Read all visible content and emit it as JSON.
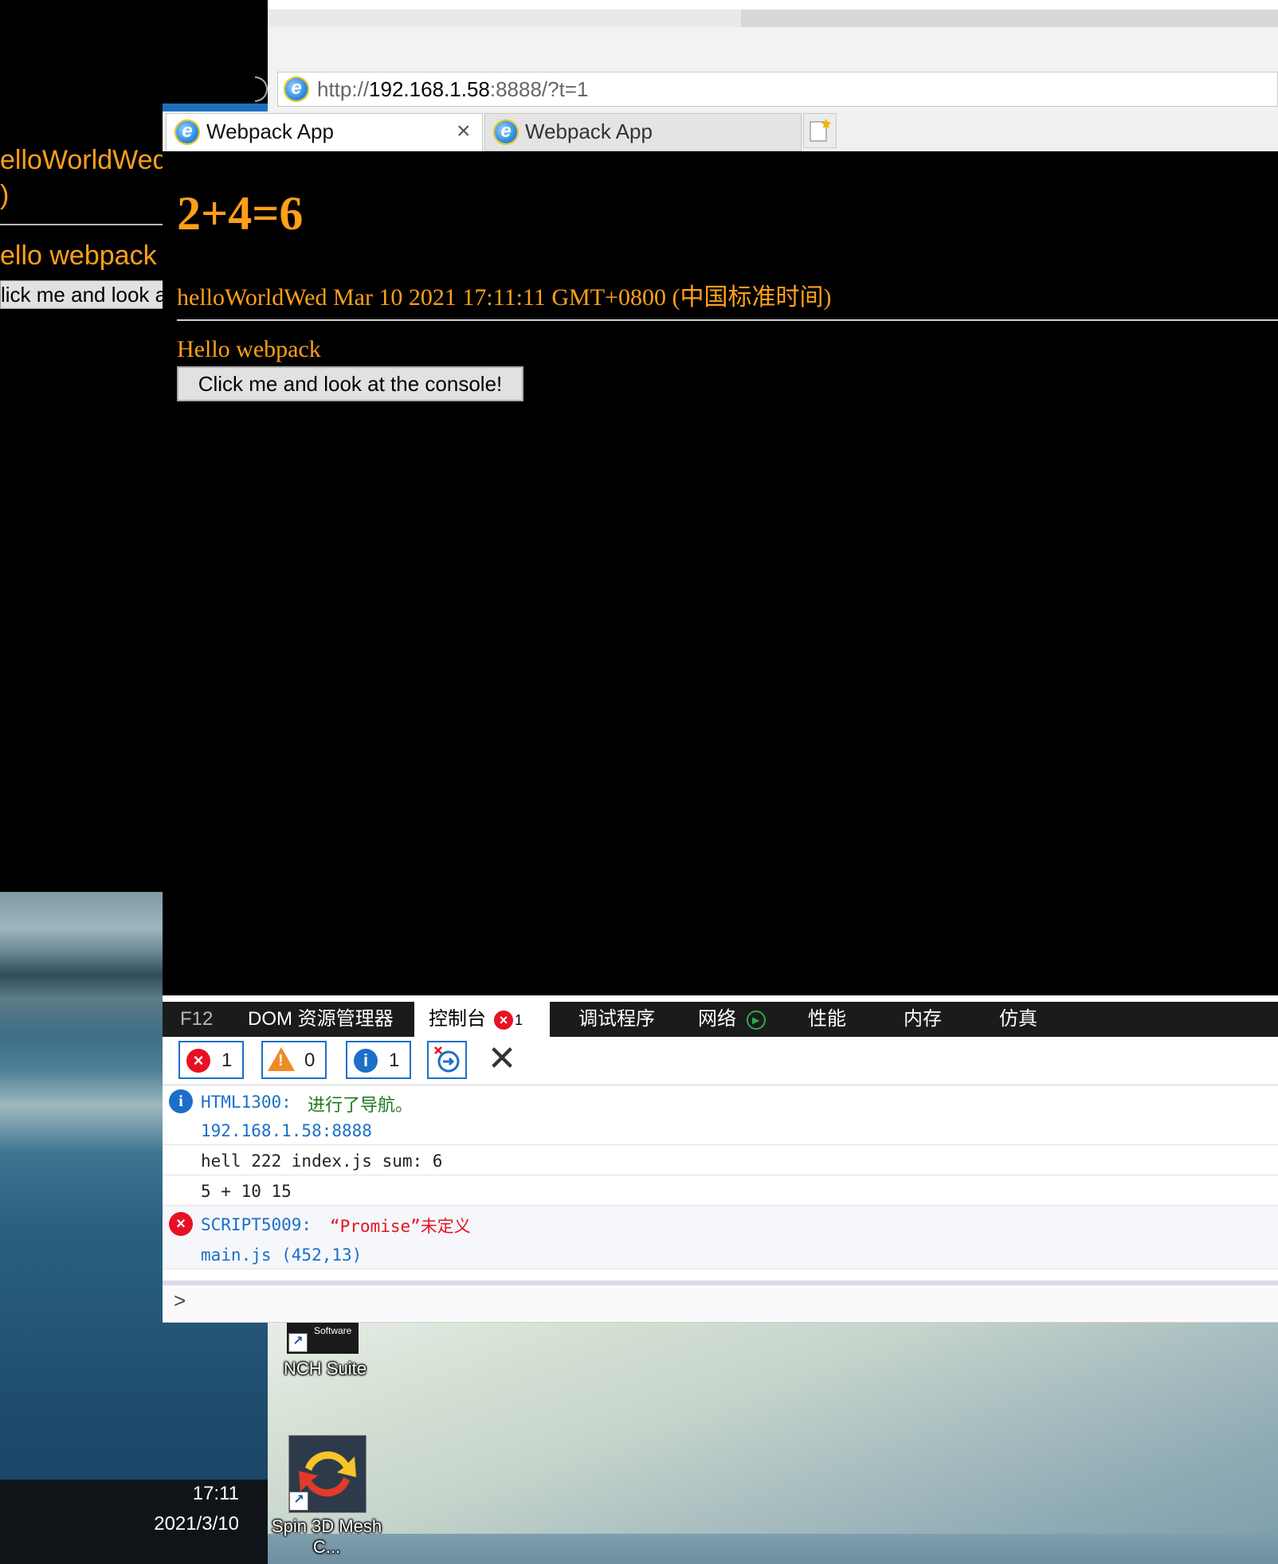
{
  "background_window": {
    "heading_partial": "elloWorldWed",
    "heading_partial_2": ")",
    "hello_partial": "ello webpack",
    "button_partial": "lick me and look a"
  },
  "browser": {
    "address": {
      "prefix": "http://",
      "host": "192.168.1.58",
      "suffix": ":8888/?t=1"
    },
    "tabs": [
      {
        "label": "Webpack App",
        "active": true
      },
      {
        "label": "Webpack App",
        "active": false
      }
    ],
    "close_glyph": "×"
  },
  "page": {
    "heading": "2+4=6",
    "date_line": "helloWorldWed Mar 10 2021 17:11:11 GMT+0800 (中国标准时间)",
    "hello_text": "Hello webpack",
    "button_label": "Click me and look at the console!"
  },
  "devtools": {
    "tabs": [
      {
        "label": "F12"
      },
      {
        "label": "DOM 资源管理器"
      },
      {
        "label": "控制台",
        "badge": "1"
      },
      {
        "label": "调试程序"
      },
      {
        "label": "网络"
      },
      {
        "label": "性能"
      },
      {
        "label": "内存"
      },
      {
        "label": "仿真"
      }
    ],
    "filters": {
      "errors": "1",
      "warnings": "0",
      "info": "1"
    },
    "messages": [
      {
        "type": "info",
        "code": "HTML1300:",
        "text": "进行了导航。",
        "source": "192.168.1.58:8888"
      },
      {
        "type": "log",
        "text": "hell 222 index.js sum: 6"
      },
      {
        "type": "log",
        "text": "5 + 10 15"
      },
      {
        "type": "error",
        "code": "SCRIPT5009:",
        "text": "“Promise”未定义",
        "source": "main.js (452,13)"
      }
    ],
    "prompt": ">"
  },
  "desktop": {
    "icons": [
      {
        "label": "NCH Suite",
        "badge_text": "Software"
      },
      {
        "label": "Spin 3D Mesh C..."
      }
    ],
    "clock": {
      "time": "17:11",
      "date": "2021/3/10"
    }
  },
  "colors": {
    "page_text": "#ff9f1a",
    "error": "#e81123",
    "info": "#1b6fc8",
    "warning": "#f08a24"
  }
}
